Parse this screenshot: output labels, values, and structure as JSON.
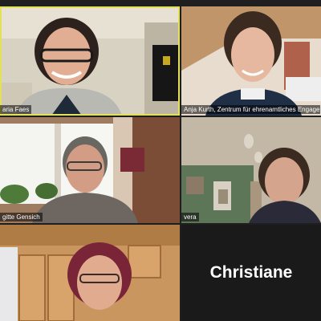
{
  "meeting": {
    "active_speaker_color": "#e3e05a",
    "participants": [
      {
        "name": "aria Faes"
      },
      {
        "name": "Anja Kurth, Zentrum für ehrenamtliches Engage..."
      },
      {
        "name": "gitte Gensich"
      },
      {
        "name": "vera"
      },
      {
        "name": ""
      },
      {
        "name": "Christiane",
        "video": "off"
      }
    ]
  }
}
